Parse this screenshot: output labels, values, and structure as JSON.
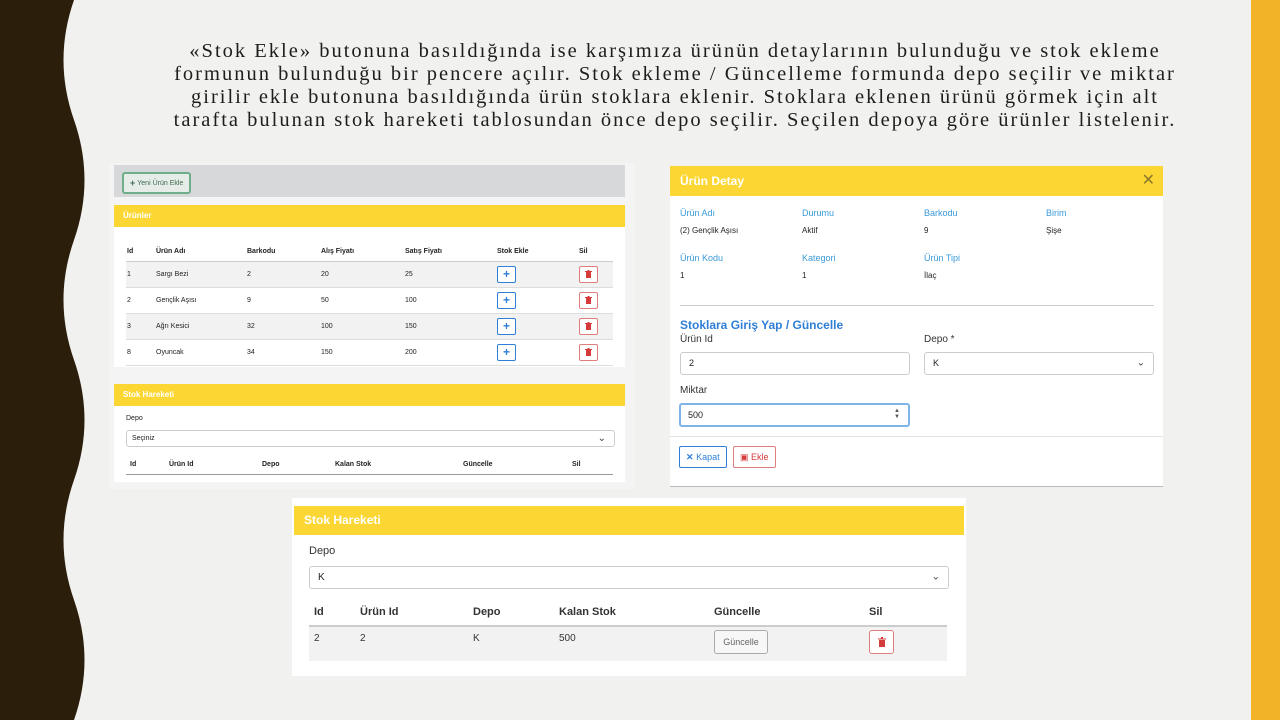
{
  "caption": [
    "«Stok Ekle» butonuna basıldığında ise karşımıza ürünün detaylarının bulunduğu ve stok ekleme",
    "formunun bulunduğu bir pencere açılır.  Stok ekleme / Güncelleme formunda depo seçilir ve miktar",
    "girilir ekle butonuna basıldığında ürün stoklara eklenir. Stoklara eklenen ürünü görmek için alt",
    "tarafta bulunan stok hareketi tablosundan önce depo seçilir. Seçilen depoya göre ürünler listelenir."
  ],
  "colors": {
    "accent_yellow": "#fcd734",
    "side_orange": "#f3b328",
    "wave_dark": "#2b1f0c",
    "primary_blue": "#2f7fd6",
    "danger_red": "#d53b3b"
  },
  "products_panel": {
    "new_button": "Yeni Ürün Ekle",
    "title": "Ürünler",
    "columns": [
      "Id",
      "Ürün Adı",
      "Barkodu",
      "Alış Fiyatı",
      "Satış Fiyatı",
      "Stok Ekle",
      "Sil"
    ],
    "rows": [
      {
        "id": "1",
        "name": "Sargı Bezi",
        "barcode": "2",
        "buy": "20",
        "sell": "25"
      },
      {
        "id": "2",
        "name": "Gençlik Aşısı",
        "barcode": "9",
        "buy": "50",
        "sell": "100"
      },
      {
        "id": "3",
        "name": "Ağrı Kesici",
        "barcode": "32",
        "buy": "100",
        "sell": "150"
      },
      {
        "id": "8",
        "name": "Oyuncak",
        "barcode": "34",
        "buy": "150",
        "sell": "200"
      }
    ],
    "icons": {
      "add": "plus-icon",
      "delete": "trash-icon"
    }
  },
  "stock_small": {
    "title": "Stok Hareketi",
    "depo_label": "Depo",
    "depo_value": "Seçiniz",
    "columns": [
      "Id",
      "Ürün Id",
      "Depo",
      "Kalan Stok",
      "Güncelle",
      "Sil"
    ]
  },
  "detail_modal": {
    "title": "Ürün Detay",
    "close_icon": "close-icon",
    "fields": [
      {
        "label": "Ürün Adı",
        "value": "(2) Gençlik Aşısı"
      },
      {
        "label": "Durumu",
        "value": "Aktif"
      },
      {
        "label": "Barkodu",
        "value": "9"
      },
      {
        "label": "Birim",
        "value": "Şişe"
      },
      {
        "label": "Ürün Kodu",
        "value": "1"
      },
      {
        "label": "Kategori",
        "value": "1"
      },
      {
        "label": "Ürün Tipi",
        "value": "İlaç"
      }
    ],
    "form_title": "Stoklara Giriş Yap / Güncelle",
    "urun_id_label": "Ürün Id",
    "urun_id_value": "2",
    "depo_label": "Depo *",
    "depo_value": "K",
    "miktar_label": "Miktar",
    "miktar_value": "500",
    "kapat_label": "Kapat",
    "ekle_label": "Ekle"
  },
  "stock_large": {
    "title": "Stok Hareketi",
    "depo_label": "Depo",
    "depo_value": "K",
    "columns": [
      "Id",
      "Ürün Id",
      "Depo",
      "Kalan Stok",
      "Güncelle",
      "Sil"
    ],
    "rows": [
      {
        "id": "2",
        "urun_id": "2",
        "depo": "K",
        "kalan": "500",
        "update_label": "Güncelle"
      }
    ]
  }
}
